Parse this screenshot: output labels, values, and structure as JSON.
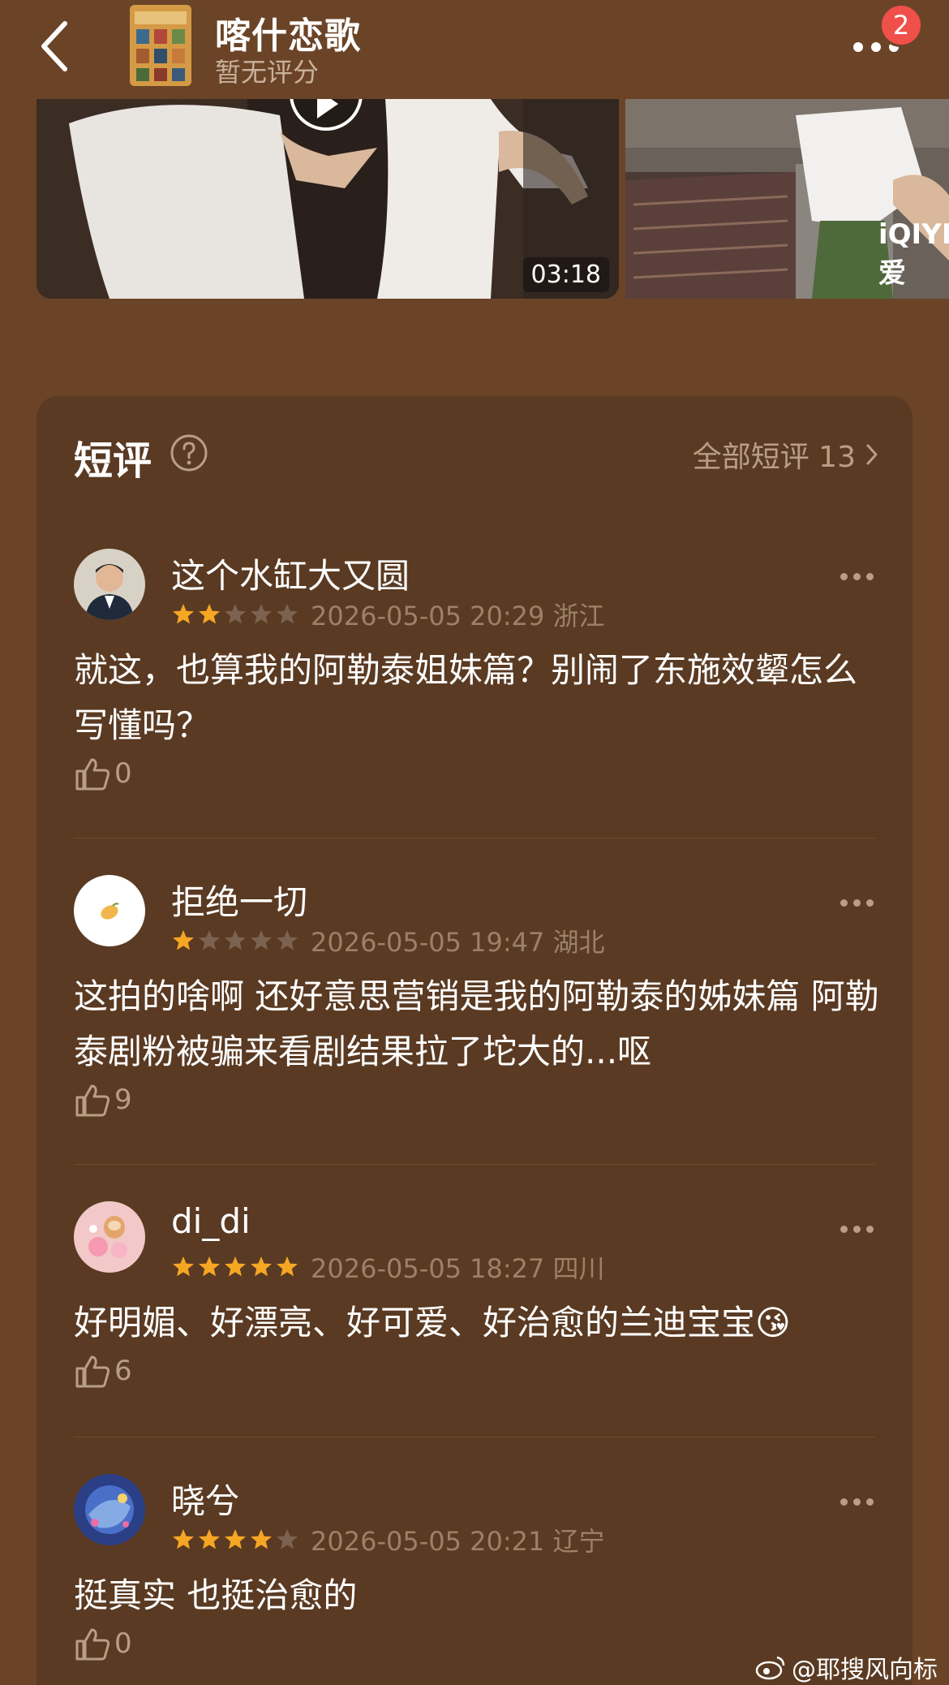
{
  "header": {
    "title": "喀什恋歌",
    "subtitle": "暂无评分",
    "notification_count": "2",
    "icons": {
      "back": "back-arrow-icon",
      "more": "more-dots-icon"
    }
  },
  "videos": [
    {
      "duration": "03:18"
    },
    {
      "watermark": "iQIYI 爱"
    }
  ],
  "reviews_section": {
    "title": "短评",
    "all_link": "全部短评 13",
    "items": [
      {
        "username": "这个水缸大又圆",
        "rating": 2,
        "meta": "2026-05-05 20:29 浙江",
        "content": "就这，也算我的阿勒泰姐妹篇？别闹了东施效颦怎么写懂吗？",
        "likes": "0"
      },
      {
        "username": "拒绝一切",
        "rating": 1,
        "meta": "2026-05-05 19:47 湖北",
        "content": "这拍的啥啊 还好意思营销是我的阿勒泰的姊妹篇 阿勒泰剧粉被骗来看剧结果拉了坨大的...呕",
        "likes": "9"
      },
      {
        "username": "di_di",
        "rating": 5,
        "meta": "2026-05-05 18:27 四川",
        "content": "好明媚、好漂亮、好可爱、好治愈的兰迪宝宝😘",
        "likes": "6"
      },
      {
        "username": "晓兮",
        "rating": 4,
        "meta": "2026-05-05 20:21 辽宁",
        "content": "挺真实 也挺治愈的",
        "likes": "0"
      }
    ]
  },
  "watermark": "@耶搜风向标",
  "colors": {
    "background": "#6b4427",
    "card": "#5a3a22",
    "star_on": "#f5a623",
    "star_off": "#7c6250",
    "muted_text": "#9c8068"
  }
}
